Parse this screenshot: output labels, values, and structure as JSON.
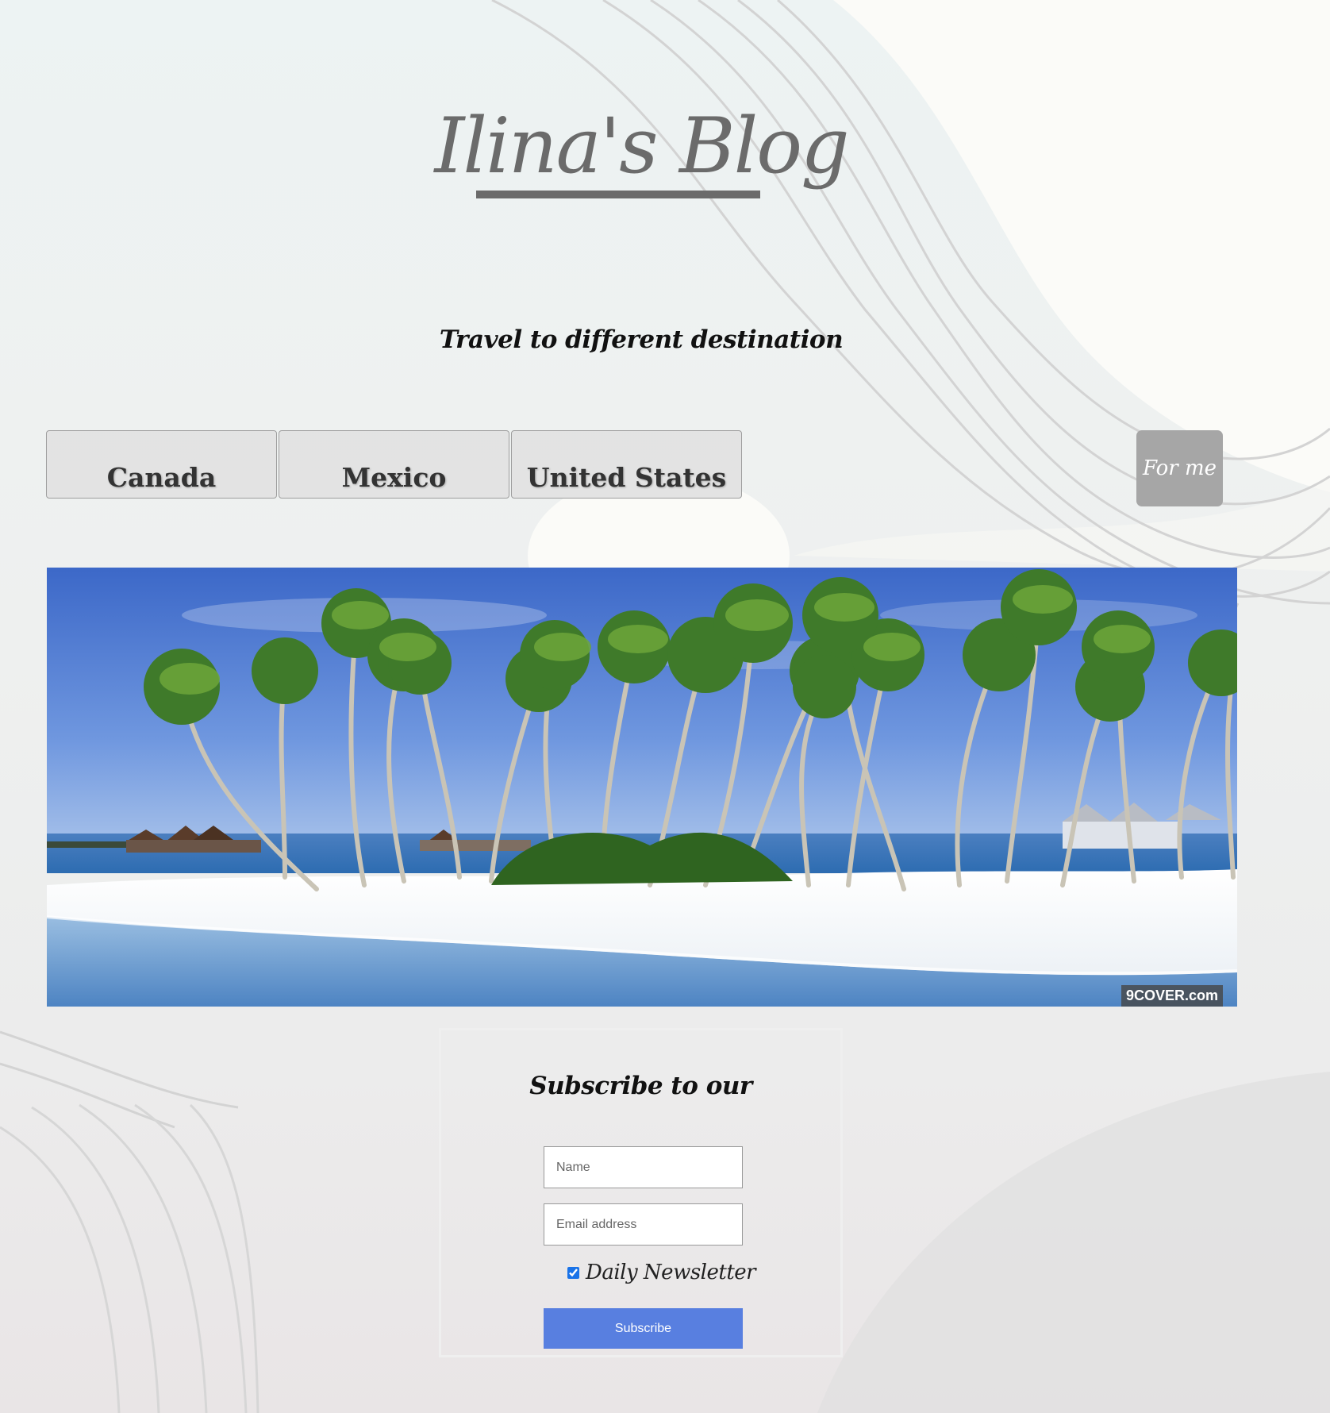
{
  "header": {
    "title": "Ilina's   Blog",
    "tagline": "Travel to different destination"
  },
  "nav": {
    "items": [
      {
        "label": "Canada"
      },
      {
        "label": "Mexico"
      },
      {
        "label": "United States"
      }
    ],
    "for_me_label": "For me"
  },
  "hero": {
    "watermark": "9COVER.com"
  },
  "subscribe": {
    "title": "Subscribe to our",
    "name_placeholder": "Name",
    "email_placeholder": "Email address",
    "newsletter_label": "Daily Newsletter",
    "newsletter_checked": true,
    "button_label": "Subscribe"
  },
  "colors": {
    "title": "#6b6b6b",
    "button_primary": "#587fe0",
    "for_me_button": "#a6a6a6"
  }
}
